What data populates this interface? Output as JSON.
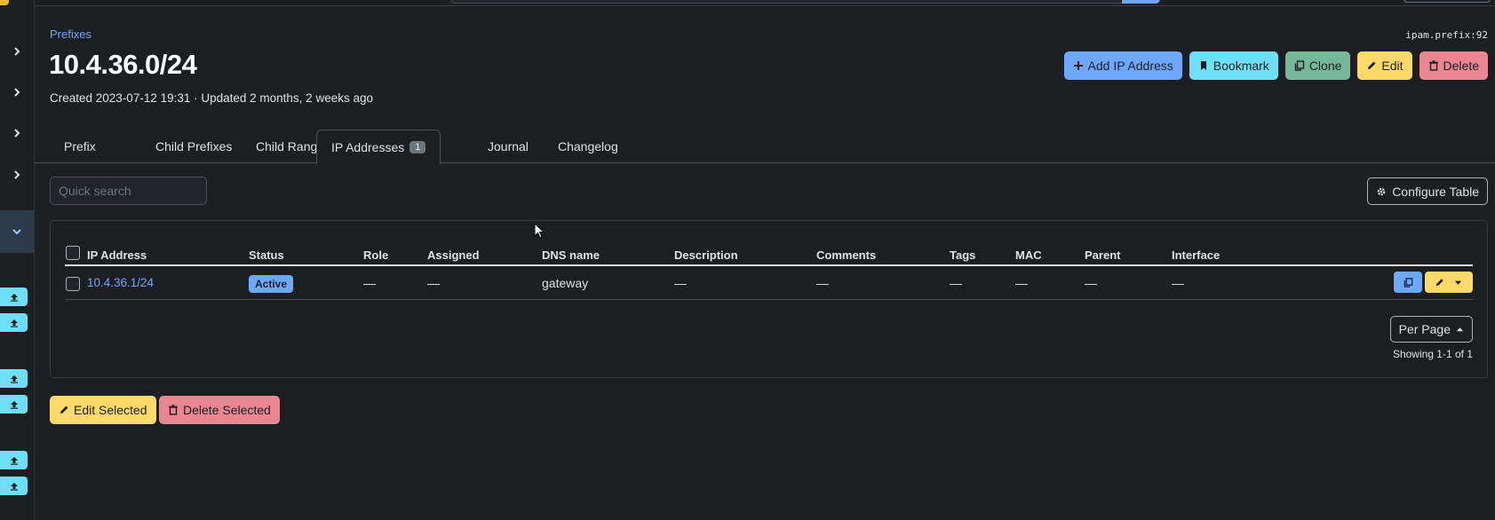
{
  "header": {
    "breadcrumb": "Prefixes",
    "title": "10.4.36.0/24",
    "meta": "Created 2023-07-12 19:31 · Updated 2 months, 2 weeks ago",
    "object_id": "ipam.prefix:92"
  },
  "actions": {
    "add_ip": "Add IP Address",
    "bookmark": "Bookmark",
    "clone": "Clone",
    "edit": "Edit",
    "delete": "Delete"
  },
  "tabs": [
    {
      "label": "Prefix"
    },
    {
      "label": "Child Prefixes"
    },
    {
      "label": "Child Ranges"
    },
    {
      "label": "IP Addresses",
      "badge": "1",
      "active": true
    },
    {
      "label": "Journal"
    },
    {
      "label": "Changelog"
    }
  ],
  "search": {
    "placeholder": "Quick search"
  },
  "configure_table": "Configure Table",
  "table": {
    "columns": [
      "IP Address",
      "Status",
      "Role",
      "Assigned",
      "DNS name",
      "Description",
      "Comments",
      "Tags",
      "MAC",
      "Parent",
      "Interface"
    ],
    "rows": [
      {
        "ip_address": "10.4.36.1/24",
        "status": "Active",
        "role": "—",
        "assigned": "—",
        "dns_name": "gateway",
        "description": "—",
        "comments": "—",
        "tags": "—",
        "mac": "—",
        "parent": "—",
        "interface": "—"
      }
    ]
  },
  "pagination": {
    "per_page": "Per Page",
    "showing": "Showing 1-1 of 1"
  },
  "bulk": {
    "edit_selected": "Edit Selected",
    "delete_selected": "Delete Selected"
  },
  "colors": {
    "primary": "#6ea8fe",
    "info": "#6edff6",
    "success": "#75b798",
    "warning": "#ffda6a",
    "danger": "#ea868f",
    "background": "#1b1f22"
  },
  "sidebar": {
    "icons": [
      "chevron-right-icon",
      "chevron-right-icon",
      "chevron-right-icon",
      "chevron-right-icon",
      "chevron-down-icon",
      "upload-icon",
      "upload-icon",
      "upload-icon",
      "upload-icon",
      "upload-icon",
      "upload-icon"
    ]
  }
}
